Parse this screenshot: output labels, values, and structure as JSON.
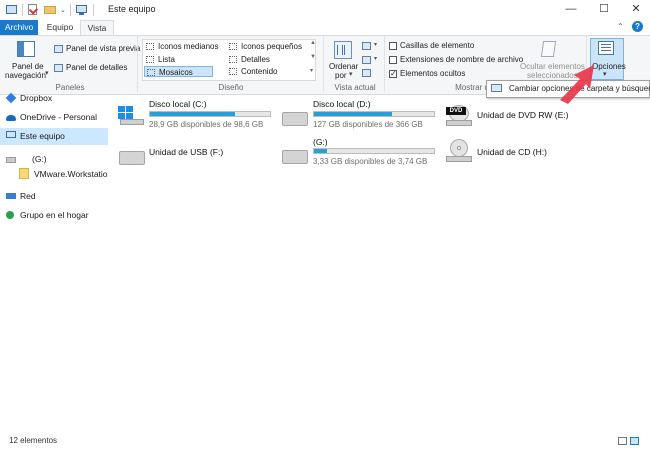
{
  "window": {
    "title": "Este equipo",
    "controls": [
      "—",
      "☐",
      "✕"
    ]
  },
  "tabs": [
    {
      "label": "Archivo"
    },
    {
      "label": "Equipo"
    },
    {
      "label": "Vista"
    }
  ],
  "ribbon": {
    "paneles": {
      "group_label": "Paneles",
      "nav_pane_label_1": "Panel de",
      "nav_pane_label_2": "navegación",
      "preview": "Panel de vista previa",
      "details": "Panel de detalles"
    },
    "diseno": {
      "group_label": "Diseño",
      "items": [
        "Iconos medianos",
        "Iconos pequeños",
        "Lista",
        "Detalles",
        "Mosaicos",
        "Contenido"
      ],
      "selected": "Mosaicos"
    },
    "vista_actual": {
      "group_label": "Vista actual",
      "sort_1": "Ordenar",
      "sort_2": "por"
    },
    "mostrar": {
      "group_label": "Mostrar u",
      "checkboxes": [
        {
          "label": "Casillas de elemento",
          "checked": false
        },
        {
          "label": "Extensiones de nombre de archivo",
          "checked": false
        },
        {
          "label": "Elementos ocultos",
          "checked": true
        }
      ],
      "hide_selected_1": "Ocultar elementos",
      "hide_selected_2": "seleccionados"
    },
    "opciones": {
      "label": "Opciones"
    }
  },
  "tooltip": {
    "text": "Cambiar opciones de carpeta y búsqueda"
  },
  "nav": {
    "items": [
      {
        "label": "Dropbox"
      },
      {
        "label": "OneDrive - Personal"
      },
      {
        "label": "Este equipo"
      },
      {
        "label": "(G:)"
      },
      {
        "label": "VMware.Workstatio"
      },
      {
        "label": "Red"
      },
      {
        "label": "Grupo en el hogar"
      }
    ]
  },
  "drives": [
    {
      "name": "Disco local (C:)",
      "free": "28,9 GB disponibles de 98,6 GB",
      "used_fraction": 0.71
    },
    {
      "name": "Disco local (D:)",
      "free": "127 GB disponibles de 366 GB",
      "used_fraction": 0.65
    },
    {
      "name": "Unidad de DVD RW (E:)",
      "dvd_badge": "DVD"
    },
    {
      "name": "Unidad de USB (F:)"
    },
    {
      "name": "(G:)",
      "free": "3,33 GB disponibles de 3,74 GB",
      "used_fraction": 0.11
    },
    {
      "name": "Unidad de CD (H:)"
    }
  ],
  "status": {
    "count": "12 elementos"
  },
  "colors": {
    "accent": "#1979ca",
    "bar_fill": "#26a0da",
    "arrow": "#e8364a"
  }
}
